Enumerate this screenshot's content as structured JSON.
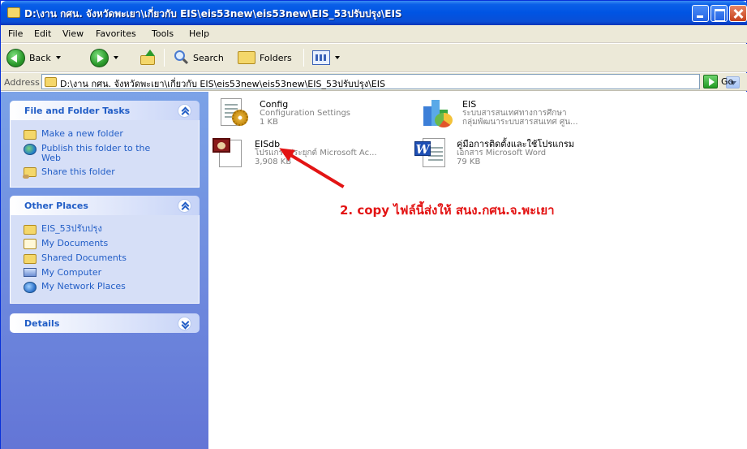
{
  "window": {
    "title": "D:\\งาน กศน. จังหวัดพะเยา\\เกี่ยวกับ EIS\\eis53new\\eis53new\\EIS_53ปรับปรุง\\EIS"
  },
  "menu": [
    "File",
    "Edit",
    "View",
    "Favorites",
    "Tools",
    "Help"
  ],
  "toolbar": {
    "back_label": "Back",
    "search_label": "Search",
    "folders_label": "Folders"
  },
  "address": {
    "label": "Address",
    "path": "D:\\งาน กศน. จังหวัดพะเยา\\เกี่ยวกับ EIS\\eis53new\\eis53new\\EIS_53ปรับปรุง\\EIS",
    "go_label": "Go"
  },
  "sidebar": {
    "file_folder_tasks": {
      "title": "File and Folder Tasks",
      "items": [
        "Make a new folder",
        "Publish this folder to the Web",
        "Share this folder"
      ]
    },
    "other_places": {
      "title": "Other Places",
      "items": [
        "EIS_53ปรับปรุง",
        "My Documents",
        "Shared Documents",
        "My Computer",
        "My Network Places"
      ]
    },
    "details": {
      "title": "Details"
    }
  },
  "files": [
    {
      "name": "Config",
      "line1": "Configuration Settings",
      "line2": "1 KB",
      "icon": "config-settings-icon"
    },
    {
      "name": "EIS",
      "line1": "ระบบสารสนเทศทางการศึกษา",
      "line2": "กลุ่มพัฒนาระบบสารสนเทศ ศูน...",
      "icon": "chart-app-icon"
    },
    {
      "name": "EISdb",
      "line1": "โปรแกรมประยุกต์ Microsoft Ac...",
      "line2": "3,908 KB",
      "icon": "access-database-icon"
    },
    {
      "name": "คู่มือการติดตั้งและใช้โปรแกรม",
      "line1": "เอกสาร Microsoft Word",
      "line2": "79 KB",
      "icon": "word-document-icon"
    }
  ],
  "annotation": {
    "text": "2. copy ไฟล์นี้ส่งให้ สนง.กศน.จ.พะเยา",
    "color": "#e31414"
  }
}
